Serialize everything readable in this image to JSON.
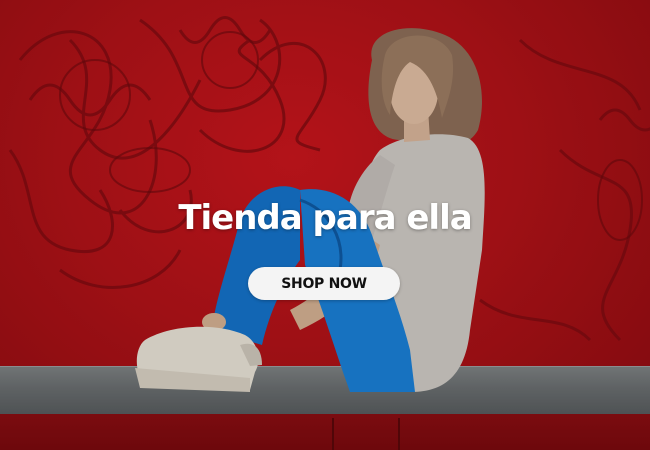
{
  "banner": {
    "headline": "Tienda para ella",
    "cta_label": "SHOP NOW"
  },
  "colors": {
    "background_red": "#b01218",
    "cta_background": "#f4f4f4",
    "cta_text": "#111111",
    "headline_text": "#ffffff"
  },
  "image": {
    "subject": "hero-photo"
  }
}
